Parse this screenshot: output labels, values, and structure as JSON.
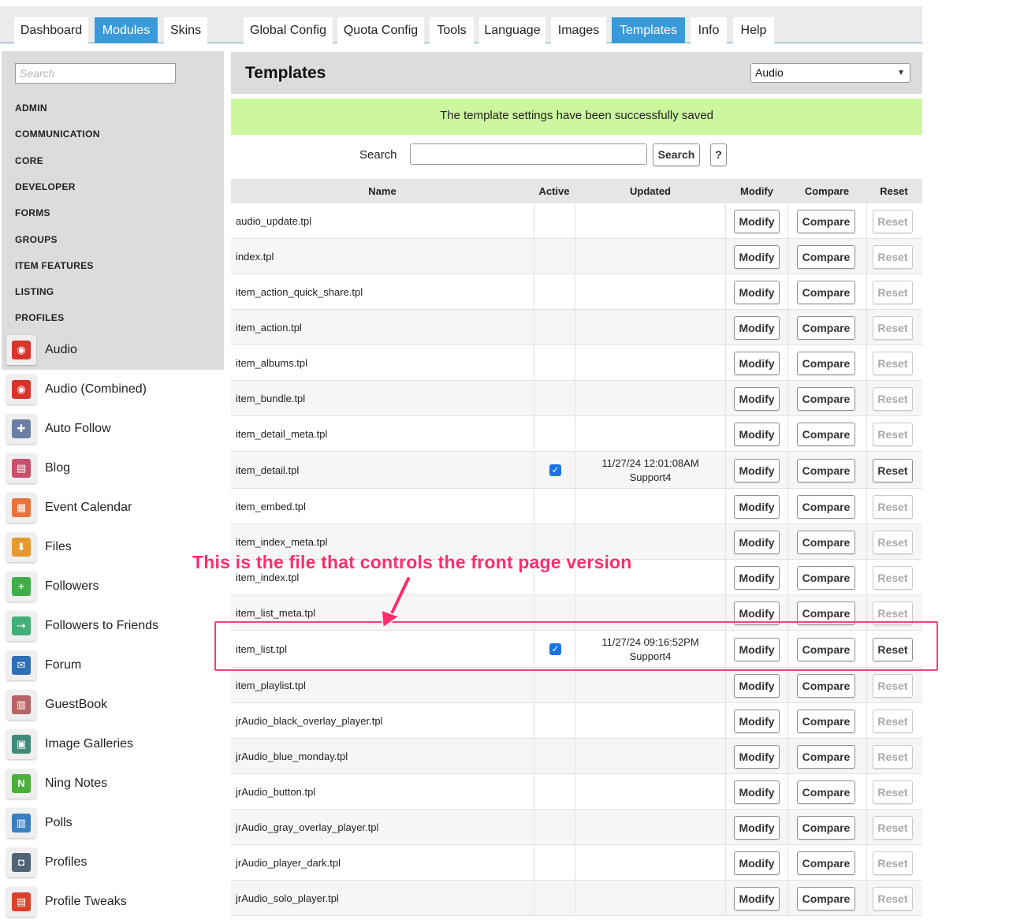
{
  "top_tabs": [
    {
      "label": "Dashboard"
    },
    {
      "label": "Modules"
    },
    {
      "label": "Skins"
    },
    {
      "label": "Global Config"
    },
    {
      "label": "Quota Config"
    },
    {
      "label": "Tools"
    },
    {
      "label": "Language"
    },
    {
      "label": "Images"
    },
    {
      "label": "Templates"
    },
    {
      "label": "Info"
    },
    {
      "label": "Help"
    }
  ],
  "active_tabs": [
    "Modules",
    "Templates"
  ],
  "sidebar": {
    "search_placeholder": "Search",
    "categories": [
      "ADMIN",
      "COMMUNICATION",
      "CORE",
      "DEVELOPER",
      "FORMS",
      "GROUPS",
      "ITEM FEATURES",
      "LISTING",
      "PROFILES"
    ],
    "modules": [
      {
        "label": "Audio",
        "icon": "audio-icon",
        "color": "#d9342b",
        "glyph": "◉",
        "selected": true
      },
      {
        "label": "Audio (Combined)",
        "icon": "audio-combined-icon",
        "color": "#d9342b",
        "glyph": "◉"
      },
      {
        "label": "Auto Follow",
        "icon": "auto-follow-icon",
        "color": "#6b7fa6",
        "glyph": "✚"
      },
      {
        "label": "Blog",
        "icon": "blog-icon",
        "color": "#c94f6d",
        "glyph": "▤"
      },
      {
        "label": "Event Calendar",
        "icon": "event-calendar-icon",
        "color": "#e8733a",
        "glyph": "▦"
      },
      {
        "label": "Files",
        "icon": "files-icon",
        "color": "#e59a2f",
        "glyph": "⬇"
      },
      {
        "label": "Followers",
        "icon": "followers-icon",
        "color": "#3fae4a",
        "glyph": "+"
      },
      {
        "label": "Followers to Friends",
        "icon": "followers-to-friends-icon",
        "color": "#43b07a",
        "glyph": "⇢"
      },
      {
        "label": "Forum",
        "icon": "forum-icon",
        "color": "#2f6fb5",
        "glyph": "✉"
      },
      {
        "label": "GuestBook",
        "icon": "guestbook-icon",
        "color": "#b86464",
        "glyph": "▥"
      },
      {
        "label": "Image Galleries",
        "icon": "image-galleries-icon",
        "color": "#3f8a7a",
        "glyph": "▣"
      },
      {
        "label": "Ning Notes",
        "icon": "ning-notes-icon",
        "color": "#4caf3a",
        "glyph": "N"
      },
      {
        "label": "Polls",
        "icon": "polls-icon",
        "color": "#3a7fc0",
        "glyph": "▥"
      },
      {
        "label": "Profiles",
        "icon": "profiles-icon",
        "color": "#4f6277",
        "glyph": "◘"
      },
      {
        "label": "Profile Tweaks",
        "icon": "profile-tweaks-icon",
        "color": "#d9432b",
        "glyph": "▤"
      }
    ]
  },
  "main": {
    "title": "Templates",
    "module_select_value": "Audio",
    "success_message": "The template settings have been successfully saved",
    "search_label": "Search",
    "search_button": "Search",
    "help_button": "?"
  },
  "table": {
    "headers": [
      "Name",
      "Active",
      "Updated",
      "Modify",
      "Compare",
      "Reset"
    ],
    "modify_label": "Modify",
    "compare_label": "Compare",
    "reset_label": "Reset",
    "rows": [
      {
        "name": "audio_update.tpl",
        "active": false,
        "date": "",
        "user": ""
      },
      {
        "name": "index.tpl",
        "active": false,
        "date": "",
        "user": ""
      },
      {
        "name": "item_action_quick_share.tpl",
        "active": false,
        "date": "",
        "user": ""
      },
      {
        "name": "item_action.tpl",
        "active": false,
        "date": "",
        "user": ""
      },
      {
        "name": "item_albums.tpl",
        "active": false,
        "date": "",
        "user": ""
      },
      {
        "name": "item_bundle.tpl",
        "active": false,
        "date": "",
        "user": ""
      },
      {
        "name": "item_detail_meta.tpl",
        "active": false,
        "date": "",
        "user": ""
      },
      {
        "name": "item_detail.tpl",
        "active": true,
        "date": "11/27/24 12:01:08AM",
        "user": "Support4"
      },
      {
        "name": "item_embed.tpl",
        "active": false,
        "date": "",
        "user": ""
      },
      {
        "name": "item_index_meta.tpl",
        "active": false,
        "date": "",
        "user": ""
      },
      {
        "name": "item_index.tpl",
        "active": false,
        "date": "",
        "user": ""
      },
      {
        "name": "item_list_meta.tpl",
        "active": false,
        "date": "",
        "user": ""
      },
      {
        "name": "item_list.tpl",
        "active": true,
        "date": "11/27/24 09:16:52PM",
        "user": "Support4"
      },
      {
        "name": "item_playlist.tpl",
        "active": false,
        "date": "",
        "user": ""
      },
      {
        "name": "jrAudio_black_overlay_player.tpl",
        "active": false,
        "date": "",
        "user": ""
      },
      {
        "name": "jrAudio_blue_monday.tpl",
        "active": false,
        "date": "",
        "user": ""
      },
      {
        "name": "jrAudio_button.tpl",
        "active": false,
        "date": "",
        "user": ""
      },
      {
        "name": "jrAudio_gray_overlay_player.tpl",
        "active": false,
        "date": "",
        "user": ""
      },
      {
        "name": "jrAudio_player_dark.tpl",
        "active": false,
        "date": "",
        "user": ""
      },
      {
        "name": "jrAudio_solo_player.tpl",
        "active": false,
        "date": "",
        "user": ""
      }
    ]
  },
  "annotation": {
    "text": "This is the file that controls the front page version",
    "color": "#ff2d6b"
  }
}
